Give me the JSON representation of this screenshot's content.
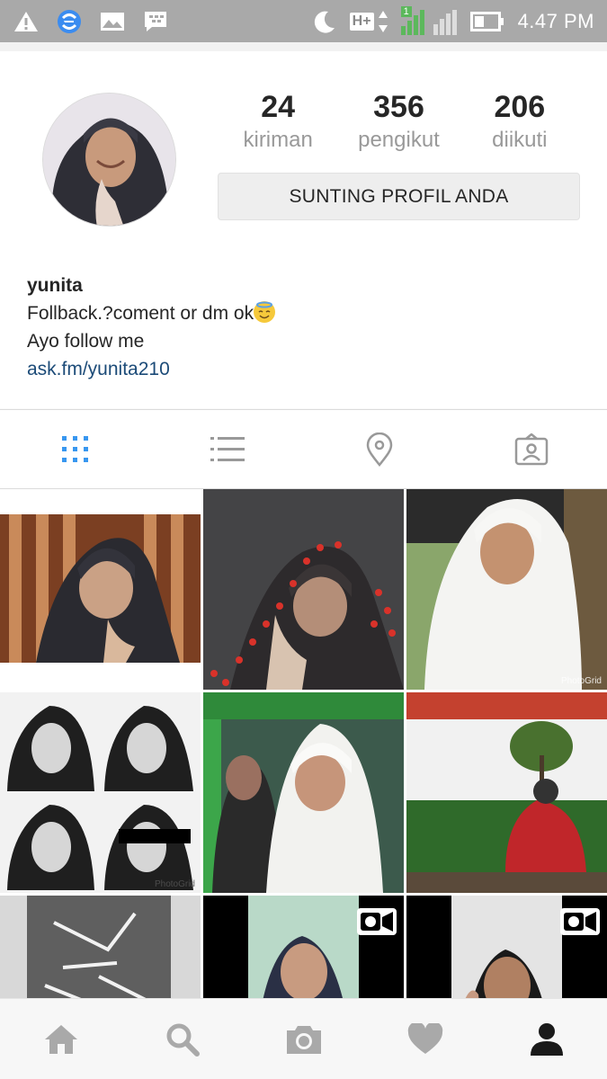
{
  "status_bar": {
    "time": "4.47 PM",
    "network": "H+",
    "sim_badge": "1",
    "icons": [
      "warning-icon",
      "sync-icon",
      "gallery-icon",
      "bbm-icon",
      "moon-icon",
      "network-icon",
      "signal-icon",
      "battery-icon"
    ]
  },
  "profile": {
    "stats": [
      {
        "value": "24",
        "label": "kiriman"
      },
      {
        "value": "356",
        "label": "pengikut"
      },
      {
        "value": "206",
        "label": "diikuti"
      }
    ],
    "edit_button_label": "SUNTING PROFIL ANDA",
    "name": "yunita",
    "bio_line1": "Follback.?coment or dm ok",
    "bio_line2": "Ayo follow me",
    "link": "ask.fm/yunita210"
  },
  "tabs": [
    "grid-view-icon",
    "list-view-icon",
    "location-icon",
    "tagged-icon"
  ],
  "grid": {
    "watermarks": [
      "PhotoGrid",
      "PhotoGrid",
      "PhotoGrid"
    ]
  },
  "bottom_nav": [
    "home-icon",
    "search-icon",
    "camera-icon",
    "heart-icon",
    "profile-icon"
  ],
  "colors": {
    "status_bar": "#a9a9a9",
    "active_tab": "#3897f0",
    "link": "#1c4b78",
    "muted": "#999999"
  }
}
